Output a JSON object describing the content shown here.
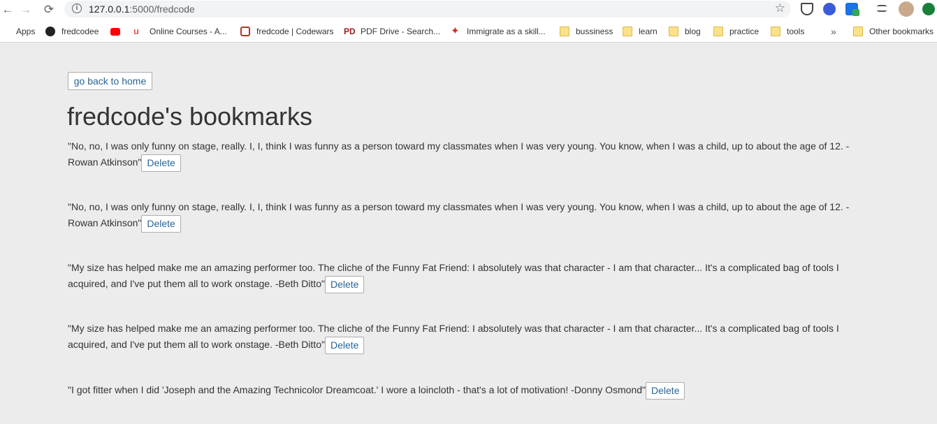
{
  "browser": {
    "url_host": "127.0.0.1",
    "url_path": ":5000/fredcode",
    "nav": {
      "back": "←",
      "forward": "→",
      "reload": "⟳"
    },
    "info_glyph": "i",
    "star_glyph": "☆",
    "more_glyph": "»",
    "bookmarks": [
      {
        "label": "Apps",
        "icon": "apps-grid-icon"
      },
      {
        "label": "fredcodee",
        "icon": "github-icon"
      },
      {
        "label": "",
        "icon": "youtube-icon"
      },
      {
        "label": "Online Courses - A...",
        "icon": "udemy-icon"
      },
      {
        "label": "fredcode | Codewars",
        "icon": "codewars-icon"
      },
      {
        "label": "PDF Drive - Search...",
        "icon": "pdfdrive-icon"
      },
      {
        "label": "Immigrate as a skill...",
        "icon": "canada-maple-icon"
      },
      {
        "label": "bussiness",
        "icon": "folder-icon"
      },
      {
        "label": "learn",
        "icon": "folder-icon"
      },
      {
        "label": "blog",
        "icon": "folder-icon"
      },
      {
        "label": "practice",
        "icon": "folder-icon"
      },
      {
        "label": "tools",
        "icon": "folder-icon"
      },
      {
        "label": "Other bookmarks",
        "icon": "folder-icon"
      }
    ]
  },
  "page": {
    "home_button": "go back to home",
    "title": "fredcode's bookmarks",
    "delete_label": "Delete",
    "quotes": [
      "\"No, no, I was only funny on stage, really. I, I, think I was funny as a person toward my classmates when I was very young. You know, when I was a child, up to about the age of 12. -Rowan Atkinson\"",
      "\"No, no, I was only funny on stage, really. I, I, think I was funny as a person toward my classmates when I was very young. You know, when I was a child, up to about the age of 12. -Rowan Atkinson\"",
      "\"My size has helped make me an amazing performer too. The cliche of the Funny Fat Friend: I absolutely was that character - I am that character... It's a complicated bag of tools I acquired, and I've put them all to work onstage. -Beth Ditto\"",
      "\"My size has helped make me an amazing performer too. The cliche of the Funny Fat Friend: I absolutely was that character - I am that character... It's a complicated bag of tools I acquired, and I've put them all to work onstage. -Beth Ditto\"",
      "\"I got fitter when I did 'Joseph and the Amazing Technicolor Dreamcoat.' I wore a loincloth - that's a lot of motivation! -Donny Osmond\""
    ]
  },
  "colors": {
    "link": "#2a6496",
    "background": "#ececec"
  }
}
